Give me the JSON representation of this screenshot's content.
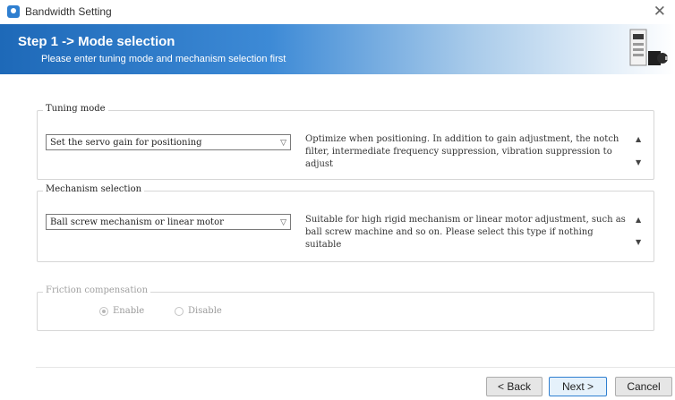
{
  "window": {
    "title": "Bandwidth Setting",
    "close_glyph": "✕"
  },
  "header": {
    "step_title": "Step 1 -> Mode selection",
    "subtitle": "Please enter tuning mode and mechanism selection first"
  },
  "tuning_mode": {
    "legend": "Tuning mode",
    "selected": "Set the servo gain for positioning",
    "description": "Optimize when positioning. In addition to gain adjustment, the notch filter, intermediate frequency suppression, vibration suppression to adjust"
  },
  "mechanism": {
    "legend": "Mechanism selection",
    "selected": "Ball screw mechanism or linear motor",
    "description": "Suitable for high rigid mechanism or linear motor adjustment, such as ball screw machine and so on. Please select this type if nothing suitable"
  },
  "friction": {
    "legend": "Friction compensation",
    "options": [
      {
        "label": "Enable",
        "checked": true
      },
      {
        "label": "Disable",
        "checked": false
      }
    ]
  },
  "buttons": {
    "back": "< Back",
    "next": "Next >",
    "cancel": "Cancel"
  },
  "colors": {
    "header_start": "#1e69b8",
    "header_end": "#ffffff",
    "accent": "#2f7fd0"
  }
}
